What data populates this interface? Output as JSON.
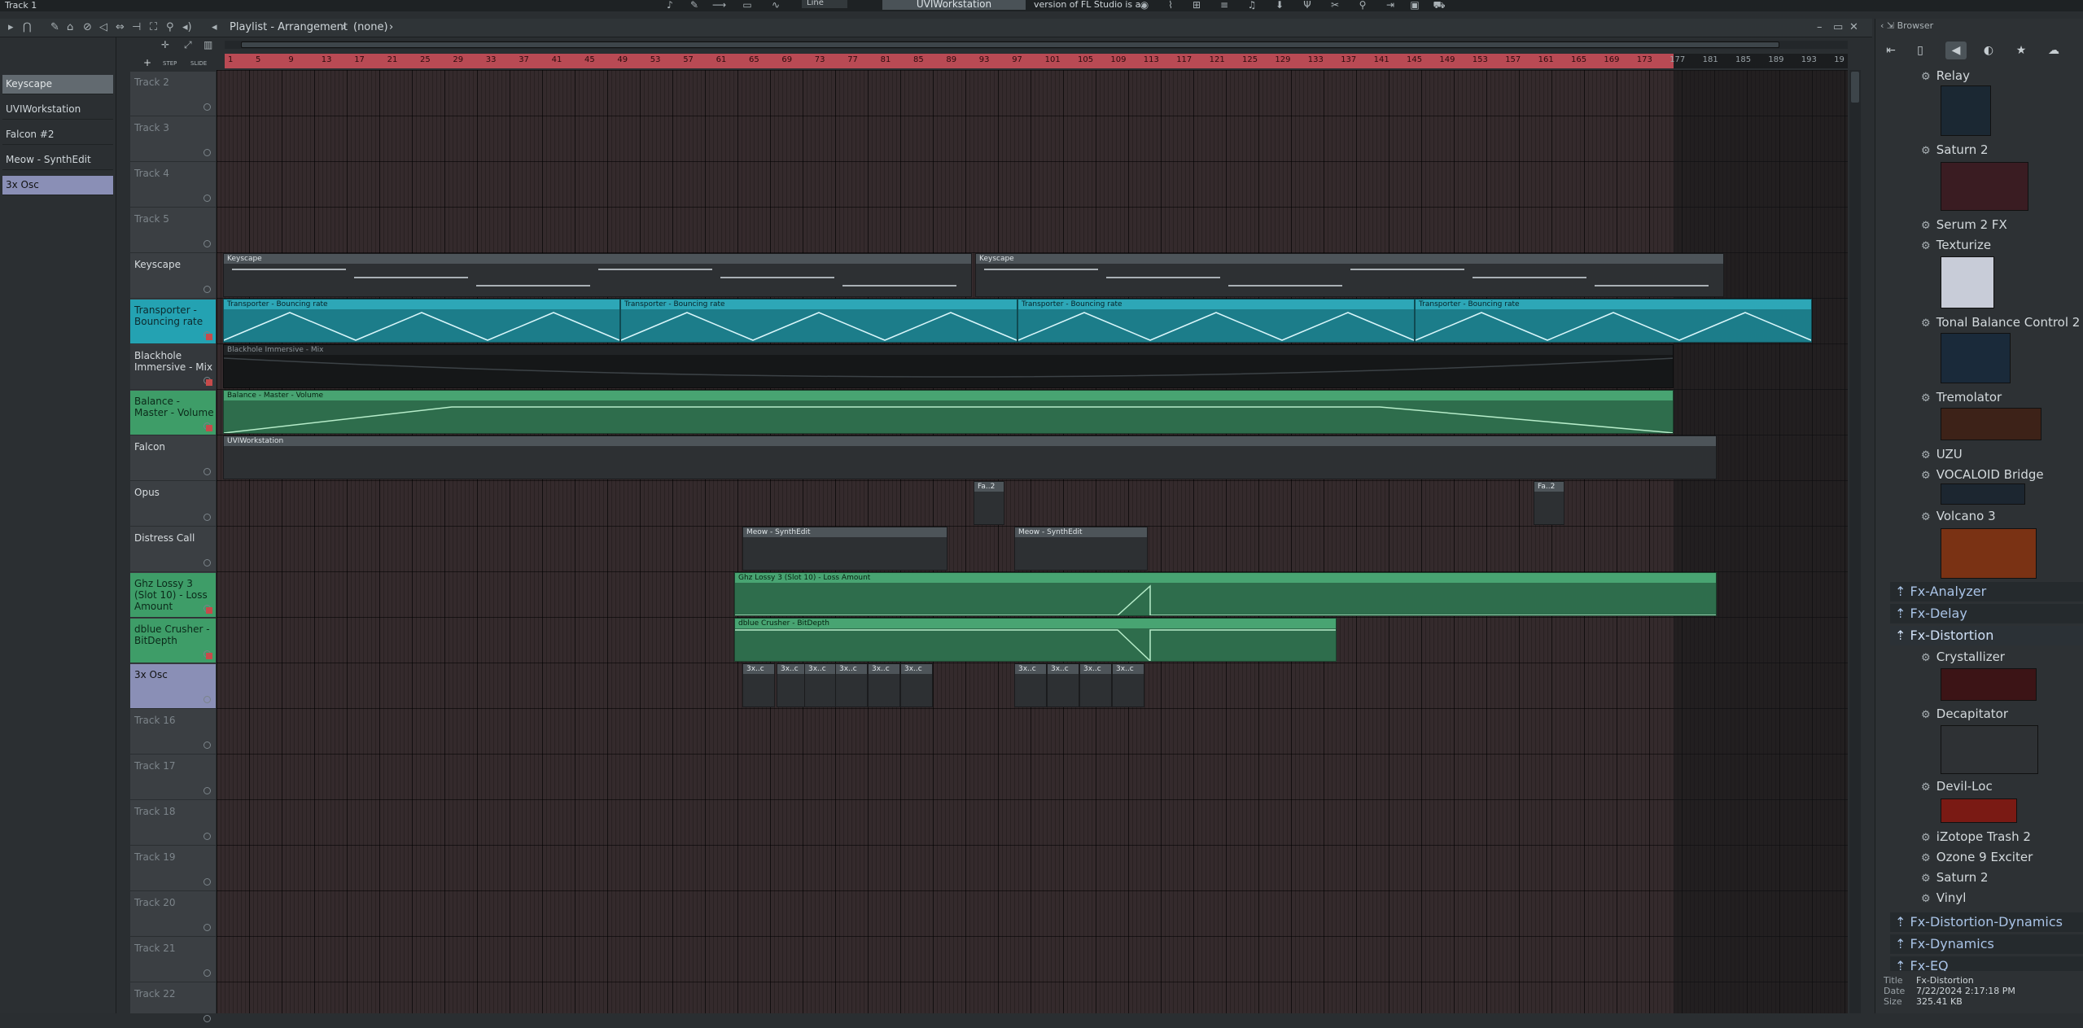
{
  "window": {
    "title": "Track 1",
    "hint_text": "version of FL Studio is a.",
    "pattern_name": "UVIWorkstation",
    "snap": "Line"
  },
  "playlist": {
    "title": "Playlist - Arrangement",
    "arrangement": "(none)",
    "step_label": "STEP",
    "slide_label": "SLIDE"
  },
  "picker": {
    "items": [
      "Keyscape",
      "UVIWorkstation",
      "Falcon #2",
      "Meow - SynthEdit",
      "3x Osc"
    ]
  },
  "ruler": {
    "bars": [
      "1",
      "5",
      "9",
      "13",
      "17",
      "21",
      "25",
      "29",
      "33",
      "37",
      "41",
      "45",
      "49",
      "53",
      "57",
      "61",
      "65",
      "69",
      "73",
      "77",
      "81",
      "85",
      "89",
      "93",
      "97",
      "101",
      "105",
      "109",
      "113",
      "117",
      "121",
      "125",
      "129",
      "133",
      "137",
      "141",
      "145",
      "149",
      "153",
      "157",
      "161",
      "165",
      "169",
      "173",
      "177",
      "181",
      "185",
      "189",
      "193",
      "19"
    ]
  },
  "tracks": [
    {
      "label": "Track 2"
    },
    {
      "label": "Track 3"
    },
    {
      "label": "Track 4"
    },
    {
      "label": "Track 5"
    },
    {
      "label": "Keyscape"
    },
    {
      "label": "Transporter - Bouncing rate"
    },
    {
      "label": "Blackhole Immersive - Mix"
    },
    {
      "label": "Balance - Master - Volume"
    },
    {
      "label": "Falcon"
    },
    {
      "label": "Opus"
    },
    {
      "label": "Distress Call"
    },
    {
      "label": "Ghz Lossy 3 (Slot 10) - Loss Amount"
    },
    {
      "label": "dblue Crusher - BitDepth"
    },
    {
      "label": "3x Osc"
    },
    {
      "label": "Track 16"
    },
    {
      "label": "Track 17"
    },
    {
      "label": "Track 18"
    },
    {
      "label": "Track 19"
    },
    {
      "label": "Track 20"
    },
    {
      "label": "Track 21"
    },
    {
      "label": "Track 22"
    }
  ],
  "clips": {
    "keyscape": "Keyscape",
    "transporter": "Transporter - Bouncing rate",
    "blackhole": "Blackhole Immersive - Mix",
    "balance": "Balance - Master - Volume",
    "uviworkstation": "UVIWorkstation",
    "fa": "Fa..2",
    "meow": "Meow - SynthEdit",
    "ghz": "Ghz Lossy 3 (Slot 10) - Loss Amount",
    "dblue": "dblue Crusher - BitDepth",
    "osc": "3x..c"
  },
  "browser": {
    "title": "Browser",
    "items": [
      "Relay",
      "Saturn 2",
      "Serum 2 FX",
      "Texturize",
      "Tonal Balance Control 2",
      "Tremolator",
      "UZU",
      "VOCALOID Bridge",
      "Volcano 3"
    ],
    "folders": [
      "Fx-Analyzer",
      "Fx-Delay",
      "Fx-Distortion"
    ],
    "dist_items": [
      "Crystallizer",
      "Decapitator",
      "Devil-Loc",
      "iZotope Trash 2",
      "Ozone 9 Exciter",
      "Saturn 2",
      "Vinyl"
    ],
    "folders2": [
      "Fx-Distortion-Dynamics",
      "Fx-Dynamics",
      "Fx-EQ"
    ],
    "info": {
      "title_label": "Title",
      "title": "Fx-Distortion",
      "date_label": "Date",
      "date": "7/22/2024 2:17:18 PM",
      "size_label": "Size",
      "size": "325.41 KB"
    }
  }
}
